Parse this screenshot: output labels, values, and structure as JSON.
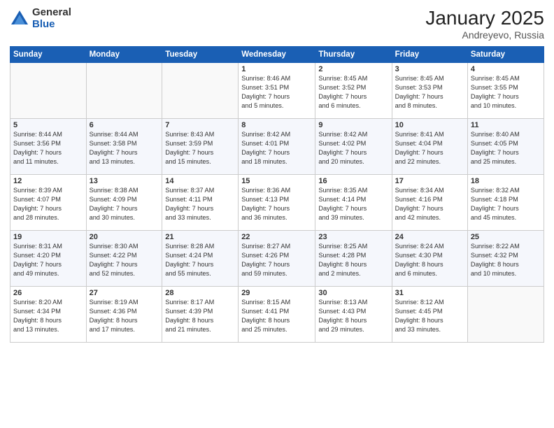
{
  "logo": {
    "general": "General",
    "blue": "Blue"
  },
  "header": {
    "month": "January 2025",
    "location": "Andreyevo, Russia"
  },
  "weekdays": [
    "Sunday",
    "Monday",
    "Tuesday",
    "Wednesday",
    "Thursday",
    "Friday",
    "Saturday"
  ],
  "weeks": [
    [
      {
        "day": "",
        "content": ""
      },
      {
        "day": "",
        "content": ""
      },
      {
        "day": "",
        "content": ""
      },
      {
        "day": "1",
        "content": "Sunrise: 8:46 AM\nSunset: 3:51 PM\nDaylight: 7 hours\nand 5 minutes."
      },
      {
        "day": "2",
        "content": "Sunrise: 8:45 AM\nSunset: 3:52 PM\nDaylight: 7 hours\nand 6 minutes."
      },
      {
        "day": "3",
        "content": "Sunrise: 8:45 AM\nSunset: 3:53 PM\nDaylight: 7 hours\nand 8 minutes."
      },
      {
        "day": "4",
        "content": "Sunrise: 8:45 AM\nSunset: 3:55 PM\nDaylight: 7 hours\nand 10 minutes."
      }
    ],
    [
      {
        "day": "5",
        "content": "Sunrise: 8:44 AM\nSunset: 3:56 PM\nDaylight: 7 hours\nand 11 minutes."
      },
      {
        "day": "6",
        "content": "Sunrise: 8:44 AM\nSunset: 3:58 PM\nDaylight: 7 hours\nand 13 minutes."
      },
      {
        "day": "7",
        "content": "Sunrise: 8:43 AM\nSunset: 3:59 PM\nDaylight: 7 hours\nand 15 minutes."
      },
      {
        "day": "8",
        "content": "Sunrise: 8:42 AM\nSunset: 4:01 PM\nDaylight: 7 hours\nand 18 minutes."
      },
      {
        "day": "9",
        "content": "Sunrise: 8:42 AM\nSunset: 4:02 PM\nDaylight: 7 hours\nand 20 minutes."
      },
      {
        "day": "10",
        "content": "Sunrise: 8:41 AM\nSunset: 4:04 PM\nDaylight: 7 hours\nand 22 minutes."
      },
      {
        "day": "11",
        "content": "Sunrise: 8:40 AM\nSunset: 4:05 PM\nDaylight: 7 hours\nand 25 minutes."
      }
    ],
    [
      {
        "day": "12",
        "content": "Sunrise: 8:39 AM\nSunset: 4:07 PM\nDaylight: 7 hours\nand 28 minutes."
      },
      {
        "day": "13",
        "content": "Sunrise: 8:38 AM\nSunset: 4:09 PM\nDaylight: 7 hours\nand 30 minutes."
      },
      {
        "day": "14",
        "content": "Sunrise: 8:37 AM\nSunset: 4:11 PM\nDaylight: 7 hours\nand 33 minutes."
      },
      {
        "day": "15",
        "content": "Sunrise: 8:36 AM\nSunset: 4:13 PM\nDaylight: 7 hours\nand 36 minutes."
      },
      {
        "day": "16",
        "content": "Sunrise: 8:35 AM\nSunset: 4:14 PM\nDaylight: 7 hours\nand 39 minutes."
      },
      {
        "day": "17",
        "content": "Sunrise: 8:34 AM\nSunset: 4:16 PM\nDaylight: 7 hours\nand 42 minutes."
      },
      {
        "day": "18",
        "content": "Sunrise: 8:32 AM\nSunset: 4:18 PM\nDaylight: 7 hours\nand 45 minutes."
      }
    ],
    [
      {
        "day": "19",
        "content": "Sunrise: 8:31 AM\nSunset: 4:20 PM\nDaylight: 7 hours\nand 49 minutes."
      },
      {
        "day": "20",
        "content": "Sunrise: 8:30 AM\nSunset: 4:22 PM\nDaylight: 7 hours\nand 52 minutes."
      },
      {
        "day": "21",
        "content": "Sunrise: 8:28 AM\nSunset: 4:24 PM\nDaylight: 7 hours\nand 55 minutes."
      },
      {
        "day": "22",
        "content": "Sunrise: 8:27 AM\nSunset: 4:26 PM\nDaylight: 7 hours\nand 59 minutes."
      },
      {
        "day": "23",
        "content": "Sunrise: 8:25 AM\nSunset: 4:28 PM\nDaylight: 8 hours\nand 2 minutes."
      },
      {
        "day": "24",
        "content": "Sunrise: 8:24 AM\nSunset: 4:30 PM\nDaylight: 8 hours\nand 6 minutes."
      },
      {
        "day": "25",
        "content": "Sunrise: 8:22 AM\nSunset: 4:32 PM\nDaylight: 8 hours\nand 10 minutes."
      }
    ],
    [
      {
        "day": "26",
        "content": "Sunrise: 8:20 AM\nSunset: 4:34 PM\nDaylight: 8 hours\nand 13 minutes."
      },
      {
        "day": "27",
        "content": "Sunrise: 8:19 AM\nSunset: 4:36 PM\nDaylight: 8 hours\nand 17 minutes."
      },
      {
        "day": "28",
        "content": "Sunrise: 8:17 AM\nSunset: 4:39 PM\nDaylight: 8 hours\nand 21 minutes."
      },
      {
        "day": "29",
        "content": "Sunrise: 8:15 AM\nSunset: 4:41 PM\nDaylight: 8 hours\nand 25 minutes."
      },
      {
        "day": "30",
        "content": "Sunrise: 8:13 AM\nSunset: 4:43 PM\nDaylight: 8 hours\nand 29 minutes."
      },
      {
        "day": "31",
        "content": "Sunrise: 8:12 AM\nSunset: 4:45 PM\nDaylight: 8 hours\nand 33 minutes."
      },
      {
        "day": "",
        "content": ""
      }
    ]
  ]
}
